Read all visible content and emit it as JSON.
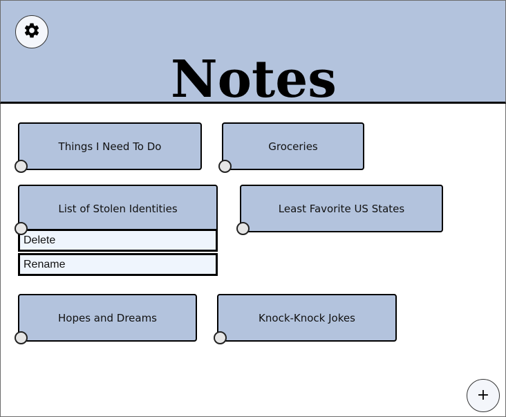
{
  "header": {
    "title": "Notes",
    "settings_icon": "gear-icon"
  },
  "notes": [
    {
      "label": "Things I Need To Do"
    },
    {
      "label": "Groceries"
    },
    {
      "label": "List of Stolen Identities"
    },
    {
      "label": "Least Favorite US States"
    },
    {
      "label": "Hopes and Dreams"
    },
    {
      "label": "Knock-Knock Jokes"
    }
  ],
  "context_menu": {
    "items": [
      {
        "label": "Delete"
      },
      {
        "label": "Rename"
      }
    ]
  },
  "add_button": {
    "label": "+"
  },
  "colors": {
    "header_bg": "#b3c3dd",
    "note_bg": "#b3c3dd",
    "menu_bg": "#eff5fd",
    "button_bg": "#f4f6fb"
  }
}
